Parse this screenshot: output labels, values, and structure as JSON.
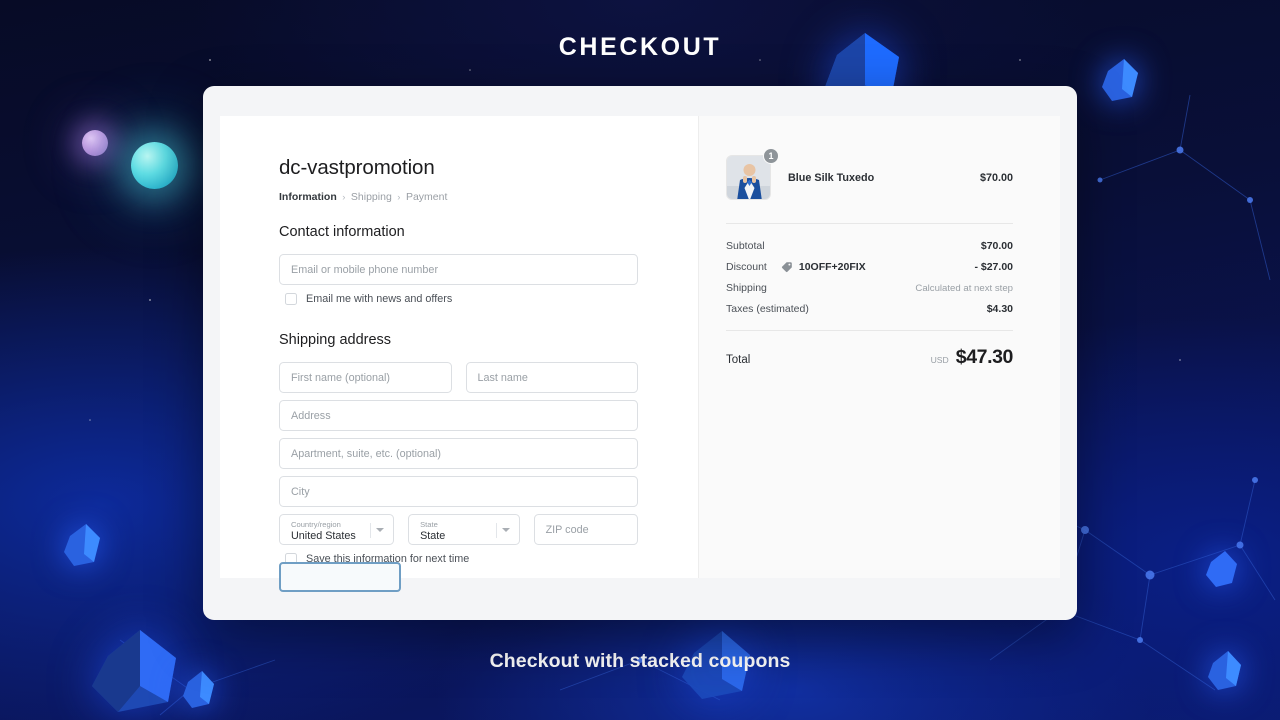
{
  "headline": "CHECKOUT",
  "caption": "Checkout with stacked coupons",
  "checkout": {
    "shop_title": "dc-vastpromotion",
    "breadcrumb": {
      "active": "Information",
      "step2": "Shipping",
      "step3": "Payment",
      "separator": "›"
    },
    "contact": {
      "section_title": "Contact information",
      "email_placeholder": "Email or mobile phone number",
      "email_value": "",
      "newsletter_label": "Email me with news and offers",
      "newsletter_checked": false
    },
    "shipping": {
      "section_title": "Shipping address",
      "first_name_placeholder": "First name (optional)",
      "last_name_placeholder": "Last name",
      "address_placeholder": "Address",
      "apartment_placeholder": "Apartment, suite, etc. (optional)",
      "city_placeholder": "City",
      "country_label": "Country/region",
      "country_value": "United States",
      "state_label": "State",
      "state_value": "State",
      "zip_placeholder": "ZIP code",
      "save_info_label": "Save this information for next time",
      "save_info_checked": false
    }
  },
  "summary": {
    "product": {
      "name": "Blue Silk Tuxedo",
      "price": "$70.00",
      "quantity": "1"
    },
    "lines": [
      {
        "label": "Subtotal",
        "value": "$70.00",
        "muted": false,
        "code": null
      },
      {
        "label": "Discount",
        "value": "- $27.00",
        "muted": false,
        "code": "10OFF+20FIX"
      },
      {
        "label": "Shipping",
        "value": "Calculated at next step",
        "muted": true,
        "code": null
      },
      {
        "label": "Taxes (estimated)",
        "value": "$4.30",
        "muted": false,
        "code": null
      }
    ],
    "total": {
      "label": "Total",
      "currency": "USD",
      "value": "$47.30"
    }
  },
  "colors": {
    "accent_button_border": "#6f9ec4",
    "badge_grey": "#8e9499",
    "background_deep_blue": "#0a1456"
  }
}
